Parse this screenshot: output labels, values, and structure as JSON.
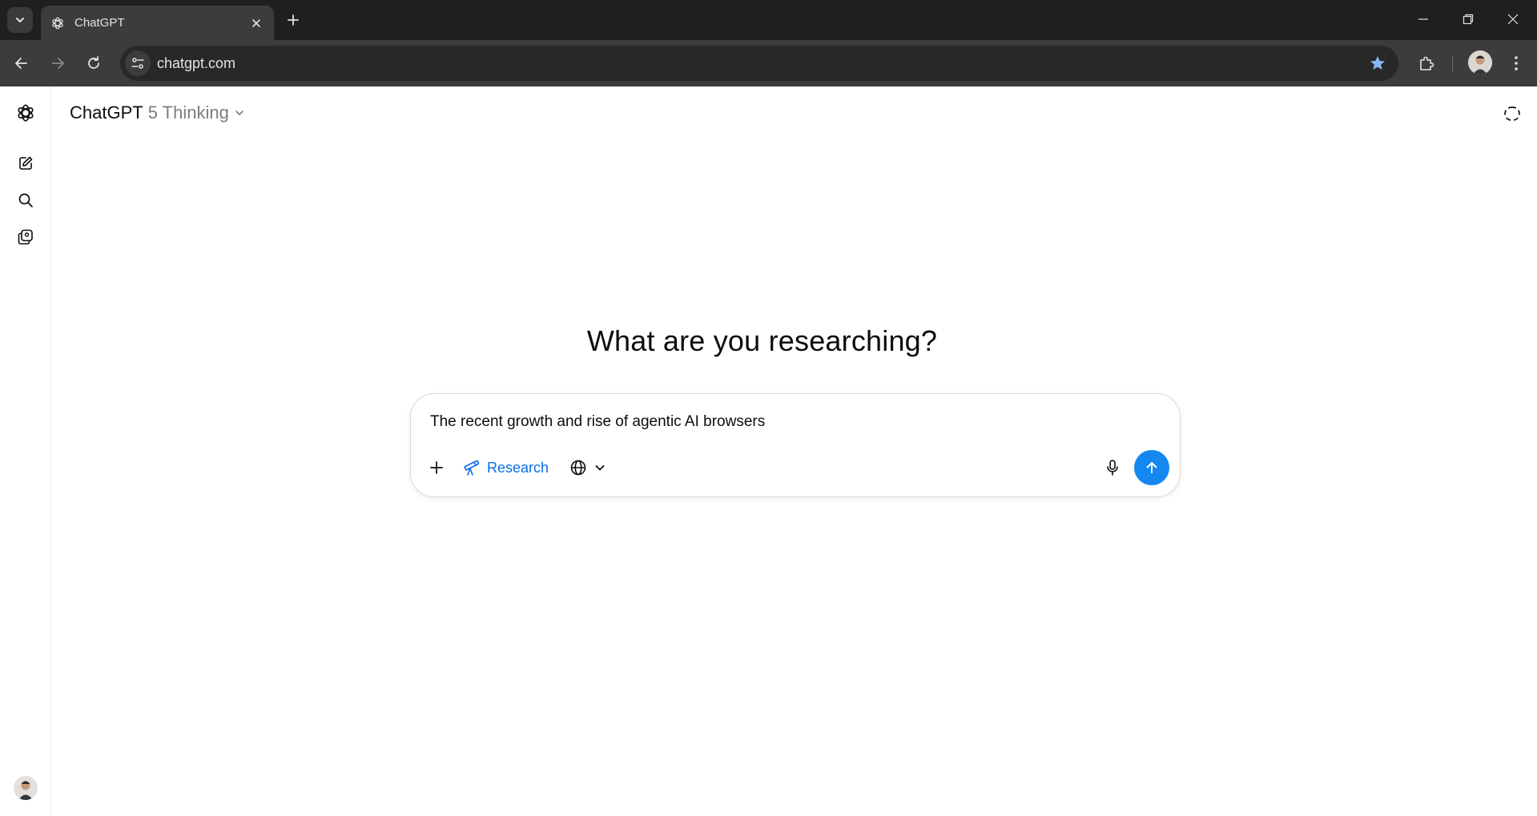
{
  "tabstrip": {
    "active_tab_title": "ChatGPT",
    "icons": [
      "tab-search-icon",
      "openai-logo-icon",
      "close-icon",
      "plus-icon",
      "minimize-icon",
      "restore-icon",
      "close-window-icon"
    ]
  },
  "toolbar": {
    "url": "chatgpt.com",
    "bookmarked": true,
    "accent_color": "#8ab4f8"
  },
  "sidebar": {
    "items": [
      {
        "name": "new-chat",
        "icon": "compose-icon"
      },
      {
        "name": "search-chats",
        "icon": "search-icon"
      },
      {
        "name": "library",
        "icon": "images-icon"
      }
    ]
  },
  "header": {
    "model_name": "ChatGPT",
    "model_variant": "5 Thinking"
  },
  "main": {
    "headline": "What are you researching?",
    "composer": {
      "value": "The recent growth and rise of agentic AI browsers",
      "research_label": "Research",
      "send_color": "#1487f0",
      "research_color": "#0a6ee8"
    }
  }
}
